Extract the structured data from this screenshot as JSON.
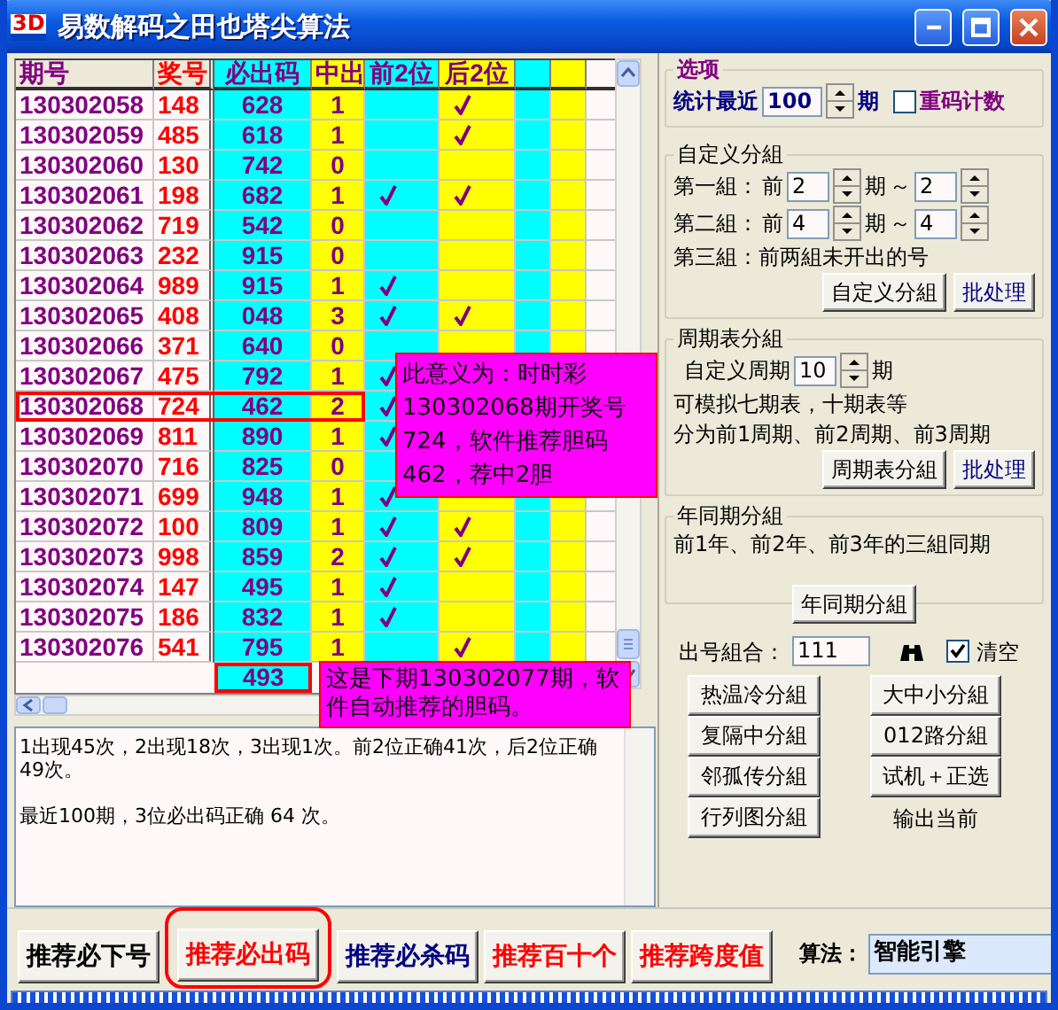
{
  "window": {
    "logo": "3D",
    "title": "易数解码之田也塔尖算法"
  },
  "table": {
    "columns": [
      "期号",
      "奖号",
      "必出码",
      "中出",
      "前2位",
      "后2位"
    ],
    "rows": [
      {
        "period": "130302058",
        "prize": "148",
        "code": "628",
        "hits": "1",
        "front2": false,
        "back2": true,
        "highlighted": false
      },
      {
        "period": "130302059",
        "prize": "485",
        "code": "618",
        "hits": "1",
        "front2": false,
        "back2": true,
        "highlighted": false
      },
      {
        "period": "130302060",
        "prize": "130",
        "code": "742",
        "hits": "0",
        "front2": false,
        "back2": false,
        "highlighted": false
      },
      {
        "period": "130302061",
        "prize": "198",
        "code": "682",
        "hits": "1",
        "front2": true,
        "back2": true,
        "highlighted": false
      },
      {
        "period": "130302062",
        "prize": "719",
        "code": "542",
        "hits": "0",
        "front2": false,
        "back2": false,
        "highlighted": false
      },
      {
        "period": "130302063",
        "prize": "232",
        "code": "915",
        "hits": "0",
        "front2": false,
        "back2": false,
        "highlighted": false
      },
      {
        "period": "130302064",
        "prize": "989",
        "code": "915",
        "hits": "1",
        "front2": true,
        "back2": false,
        "highlighted": false
      },
      {
        "period": "130302065",
        "prize": "408",
        "code": "048",
        "hits": "3",
        "front2": true,
        "back2": true,
        "highlighted": false
      },
      {
        "period": "130302066",
        "prize": "371",
        "code": "640",
        "hits": "0",
        "front2": false,
        "back2": false,
        "highlighted": false
      },
      {
        "period": "130302067",
        "prize": "475",
        "code": "792",
        "hits": "1",
        "front2": true,
        "highlighted": false
      },
      {
        "period": "130302068",
        "prize": "724",
        "code": "462",
        "hits": "2",
        "front2": true,
        "highlighted": true
      },
      {
        "period": "130302069",
        "prize": "811",
        "code": "890",
        "hits": "1",
        "front2": true,
        "highlighted": false
      },
      {
        "period": "130302070",
        "prize": "716",
        "code": "825",
        "hits": "0",
        "front2": false,
        "highlighted": false
      },
      {
        "period": "130302071",
        "prize": "699",
        "code": "948",
        "hits": "1",
        "front2": true,
        "highlighted": false
      },
      {
        "period": "130302072",
        "prize": "100",
        "code": "809",
        "hits": "1",
        "front2": true,
        "back2": true,
        "highlighted": false
      },
      {
        "period": "130302073",
        "prize": "998",
        "code": "859",
        "hits": "2",
        "front2": true,
        "back2": true,
        "highlighted": false
      },
      {
        "period": "130302074",
        "prize": "147",
        "code": "495",
        "hits": "1",
        "front2": true,
        "back2": false,
        "highlighted": false
      },
      {
        "period": "130302075",
        "prize": "186",
        "code": "832",
        "hits": "1",
        "front2": true,
        "back2": false,
        "highlighted": false
      },
      {
        "period": "130302076",
        "prize": "541",
        "code": "795",
        "hits": "1",
        "front2": false,
        "back2": true,
        "highlighted": false
      }
    ],
    "next_row": {
      "code": "493",
      "highlighted": true
    }
  },
  "callouts": [
    {
      "text": "此意义为：时时彩130302068期开奖号724，软件推荐胆码462，荐中2胆"
    },
    {
      "text": "这是下期130302077期，软件自动推荐的胆码。"
    }
  ],
  "summary": [
    "1出现45次，2出现18次，3出现1次。前2位正确41次，后2位正确49次。",
    "最近100期，3位必出码正确 64 次。"
  ],
  "options": {
    "title": "选项",
    "label": "统计最近",
    "value": "100",
    "unit": "期",
    "repeat": {
      "label": "重码计数",
      "checked": false
    }
  },
  "custom_group": {
    "title": "自定义分組",
    "rows": [
      {
        "label": "第一組：",
        "prefix": "前",
        "from": "2",
        "unit": "期",
        "sep": "～",
        "to": "2"
      },
      {
        "label": "第二組：",
        "prefix": "前",
        "from": "4",
        "unit": "期",
        "sep": "～",
        "to": "4"
      }
    ],
    "note": "第三組：前两組未开出的号",
    "button": "自定义分組",
    "batch": "批处理"
  },
  "cycle_group": {
    "title": "周期表分組",
    "label": "自定义周期",
    "value": "10",
    "unit": "期",
    "notes": [
      "可模拟七期表，十期表等",
      "分为前1周期、前2周期、前3周期"
    ],
    "button": "周期表分組",
    "batch": "批处理"
  },
  "year_group": {
    "title": "年同期分組",
    "note": "前1年、前2年、前3年的三組同期",
    "button": "年同期分組"
  },
  "combo": {
    "label": "出号組合：",
    "value": "111",
    "clear": {
      "label": "清空",
      "checked": true
    }
  },
  "group_buttons": {
    "left": [
      "热温冷分組",
      "复隔中分組",
      "邻孤传分組",
      "行列图分組"
    ],
    "right": [
      "大中小分組",
      "012路分組",
      "试机＋正选"
    ],
    "output_label": "输出当前"
  },
  "bottom_buttons": [
    {
      "label": "推荐必下号",
      "color": "#000000",
      "selected": false
    },
    {
      "label": "推荐必出码",
      "color": "#ff0000",
      "selected": true
    },
    {
      "label": "推荐必杀码",
      "color": "#000080",
      "selected": false
    },
    {
      "label": "推荐百十个",
      "color": "#ff0000",
      "selected": false
    },
    {
      "label": "推荐跨度值",
      "color": "#ff0000",
      "selected": false
    }
  ],
  "algorithm": {
    "label": "算法：",
    "value": "智能引擎"
  }
}
